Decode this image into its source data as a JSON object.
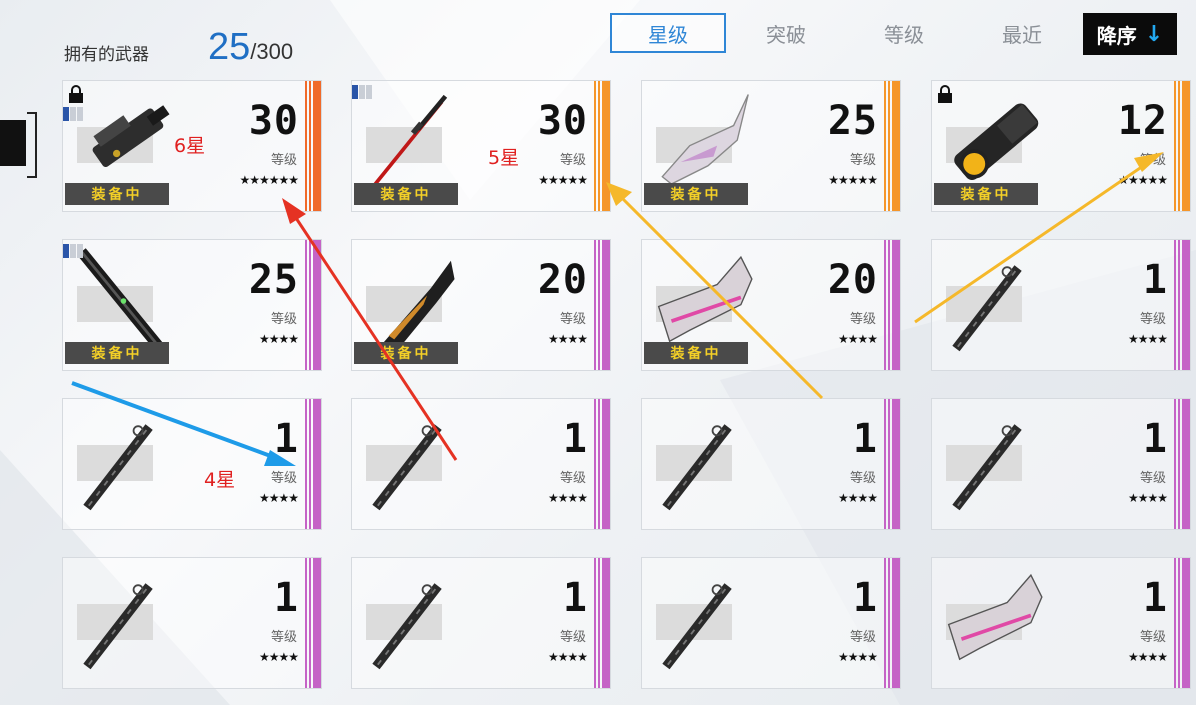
{
  "header": {
    "owned_label": "拥有的武器",
    "owned_count": "25",
    "owned_max": "/300"
  },
  "sort_tabs": [
    {
      "label": "星级",
      "active": true
    },
    {
      "label": "突破",
      "active": false
    },
    {
      "label": "等级",
      "active": false
    },
    {
      "label": "最近",
      "active": false
    }
  ],
  "order_button": {
    "label": "降序",
    "arrow": "↓"
  },
  "level_label": "等级",
  "equip_label": "装备中",
  "cards": [
    {
      "level": "30",
      "stars": "★★★★★★",
      "rarity": 6,
      "equipped": true,
      "locked": true,
      "tier": 1,
      "weapon": "heavy-cannon-icon"
    },
    {
      "level": "30",
      "stars": "★★★★★",
      "rarity": 5,
      "equipped": true,
      "locked": false,
      "tier": 1,
      "weapon": "red-katana-icon"
    },
    {
      "level": "25",
      "stars": "★★★★★",
      "rarity": 5,
      "equipped": true,
      "locked": false,
      "tier": 0,
      "weapon": "mech-blade-icon"
    },
    {
      "level": "12",
      "stars": "★★★★★",
      "rarity": 5,
      "equipped": true,
      "locked": true,
      "tier": 0,
      "weapon": "orange-core-cannon-icon"
    },
    {
      "level": "25",
      "stars": "★★★★",
      "rarity": 4,
      "equipped": true,
      "locked": false,
      "tier": 1,
      "weapon": "greatsword-icon"
    },
    {
      "level": "20",
      "stars": "★★★★",
      "rarity": 4,
      "equipped": true,
      "locked": false,
      "tier": 0,
      "weapon": "gold-axe-icon"
    },
    {
      "level": "20",
      "stars": "★★★★",
      "rarity": 4,
      "equipped": true,
      "locked": false,
      "tier": 0,
      "weapon": "pink-gun-icon"
    },
    {
      "level": "1",
      "stars": "★★★★",
      "rarity": 4,
      "equipped": false,
      "locked": false,
      "tier": 0,
      "weapon": "sheathed-sword-icon"
    },
    {
      "level": "1",
      "stars": "★★★★",
      "rarity": 4,
      "equipped": false,
      "locked": false,
      "tier": 0,
      "weapon": "sheathed-sword-icon"
    },
    {
      "level": "1",
      "stars": "★★★★",
      "rarity": 4,
      "equipped": false,
      "locked": false,
      "tier": 0,
      "weapon": "sheathed-sword-icon"
    },
    {
      "level": "1",
      "stars": "★★★★",
      "rarity": 4,
      "equipped": false,
      "locked": false,
      "tier": 0,
      "weapon": "sheathed-sword-icon"
    },
    {
      "level": "1",
      "stars": "★★★★",
      "rarity": 4,
      "equipped": false,
      "locked": false,
      "tier": 0,
      "weapon": "sheathed-sword-icon"
    },
    {
      "level": "1",
      "stars": "★★★★",
      "rarity": 4,
      "equipped": false,
      "locked": false,
      "tier": 0,
      "weapon": "sheathed-sword-icon"
    },
    {
      "level": "1",
      "stars": "★★★★",
      "rarity": 4,
      "equipped": false,
      "locked": false,
      "tier": 0,
      "weapon": "sheathed-sword-icon"
    },
    {
      "level": "1",
      "stars": "★★★★",
      "rarity": 4,
      "equipped": false,
      "locked": false,
      "tier": 0,
      "weapon": "sheathed-sword-icon"
    },
    {
      "level": "1",
      "stars": "★★★★",
      "rarity": 4,
      "equipped": false,
      "locked": false,
      "tier": 0,
      "weapon": "pink-gun-icon"
    }
  ],
  "annotations": {
    "six_star": "6星",
    "five_star": "5星",
    "four_star": "4星",
    "colors": {
      "red": "#e53223",
      "orange": "#f5b82a",
      "blue": "#1e9be8"
    }
  }
}
